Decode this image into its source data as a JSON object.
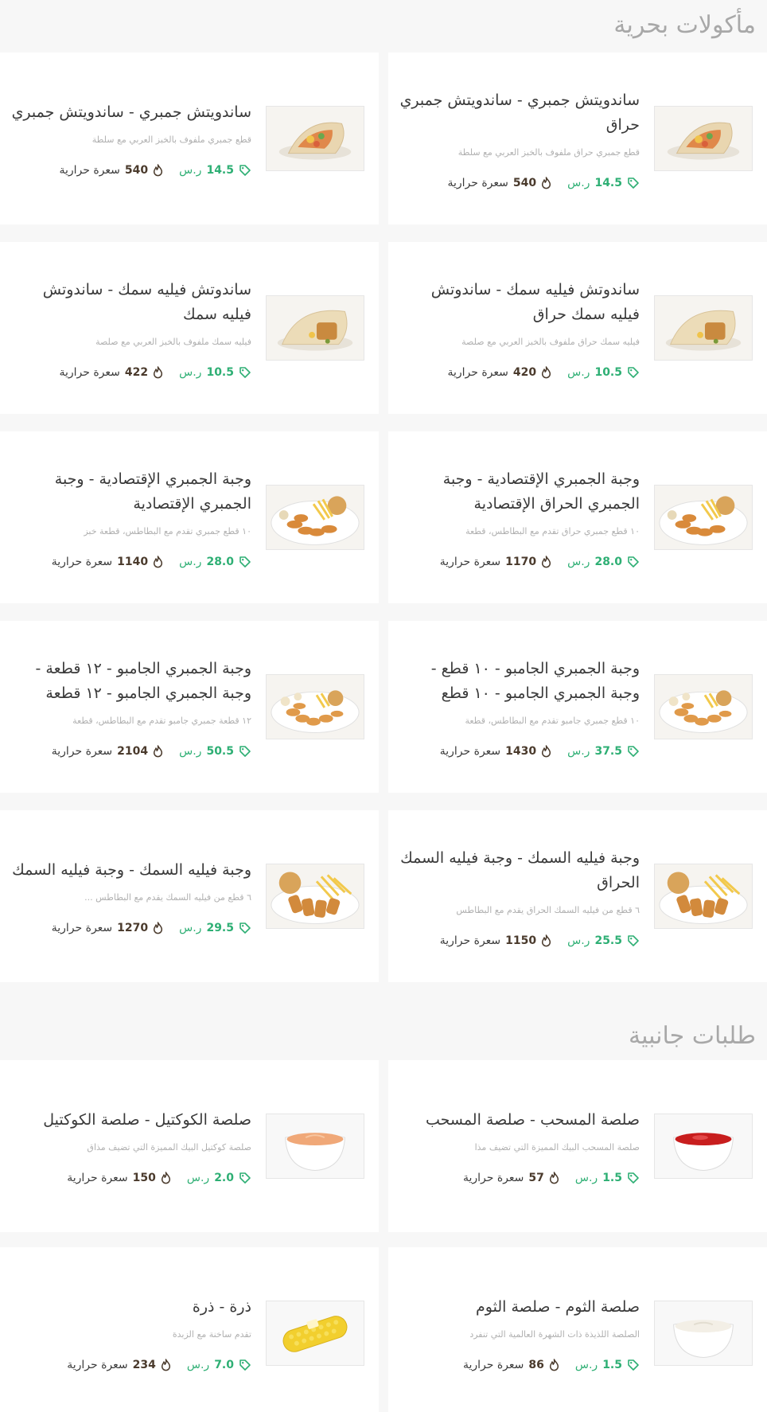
{
  "sections": [
    {
      "title": "مأكولات بحرية",
      "items": [
        {
          "name": "ساندويتش جمبري - ساندويتش جمبري حراق",
          "desc": "قطع جمبري حراق ملفوف بالخبز العربي مع سلطة",
          "price": "14.5",
          "currency": "ر.س",
          "calories": "540",
          "calories_unit": "سعرة حرارية",
          "image": "shrimp-wrap"
        },
        {
          "name": "ساندويتش جمبري - ساندويتش جمبري",
          "desc": "قطع جمبري ملفوف بالخبز العربي مع سلطة",
          "price": "14.5",
          "currency": "ر.س",
          "calories": "540",
          "calories_unit": "سعرة حرارية",
          "image": "shrimp-wrap"
        },
        {
          "name": "ساندوتش فيليه سمك - ساندوتش فيليه سمك حراق",
          "desc": "فيليه سمك حراق ملفوف بالخبز العربي مع صلصة",
          "price": "10.5",
          "currency": "ر.س",
          "calories": "420",
          "calories_unit": "سعرة حرارية",
          "image": "fish-wrap"
        },
        {
          "name": "ساندوتش فيليه سمك - ساندوتش فيليه سمك",
          "desc": "فيليه سمك ملفوف بالخبز العربي مع صلصة",
          "price": "10.5",
          "currency": "ر.س",
          "calories": "422",
          "calories_unit": "سعرة حرارية",
          "image": "fish-wrap"
        },
        {
          "name": "وجبة الجمبري الإقتصادية - وجبة الجمبري الحراق الإقتصادية",
          "desc": "١٠ قطع جمبري حراق تقدم مع البطاطس، قطعة",
          "price": "28.0",
          "currency": "ر.س",
          "calories": "1170",
          "calories_unit": "سعرة حرارية",
          "image": "shrimp-meal"
        },
        {
          "name": "وجبة الجمبري الإقتصادية - وجبة الجمبري الإقتصادية",
          "desc": "١٠ قطع جمبري تقدم مع البطاطس، قطعة خبز",
          "price": "28.0",
          "currency": "ر.س",
          "calories": "1140",
          "calories_unit": "سعرة حرارية",
          "image": "shrimp-meal"
        },
        {
          "name": "وجبة الجمبري الجامبو - ١٠ قطع - وجبة الجمبري الجامبو - ١٠ قطع",
          "desc": "١٠ قطع جمبري جامبو تقدم مع البطاطس، قطعة",
          "price": "37.5",
          "currency": "ر.س",
          "calories": "1430",
          "calories_unit": "سعرة حرارية",
          "image": "jumbo-meal"
        },
        {
          "name": "وجبة الجمبري الجامبو - ١٢ قطعة - وجبة الجمبري الجامبو - ١٢ قطعة",
          "desc": "١٢ قطعة جمبري جامبو تقدم مع البطاطس، قطعة",
          "price": "50.5",
          "currency": "ر.س",
          "calories": "2104",
          "calories_unit": "سعرة حرارية",
          "image": "jumbo-meal"
        },
        {
          "name": "وجبة فيليه السمك - وجبة فيليه السمك الحراق",
          "desc": "٦ قطع من فيليه السمك الحراق يقدم مع البطاطس",
          "price": "25.5",
          "currency": "ر.س",
          "calories": "1150",
          "calories_unit": "سعرة حرارية",
          "image": "fish-meal"
        },
        {
          "name": "وجبة فيليه السمك - وجبة فيليه السمك",
          "desc": "٦ قطع من فيليه السمك يقدم مع البطاطس ...",
          "price": "29.5",
          "currency": "ر.س",
          "calories": "1270",
          "calories_unit": "سعرة حرارية",
          "image": "fish-meal"
        }
      ]
    },
    {
      "title": "طلبات جانبية",
      "items": [
        {
          "name": "صلصة المسحب - صلصة المسحب",
          "desc": "صلصة المسحب البيك المميزة التي تضيف مذا",
          "price": "1.5",
          "currency": "ر.س",
          "calories": "57",
          "calories_unit": "سعرة حرارية",
          "image": "red-sauce"
        },
        {
          "name": "صلصة الكوكتيل - صلصة الكوكتيل",
          "desc": "صلصة كوكتيل البيك المميزة التي تضيف مذاق",
          "price": "2.0",
          "currency": "ر.س",
          "calories": "150",
          "calories_unit": "سعرة حرارية",
          "image": "cocktail-sauce"
        },
        {
          "name": "صلصة الثوم - صلصة الثوم",
          "desc": "الصلصة اللذيذة ذات الشهرة العالمية التي تنفرد",
          "price": "1.5",
          "currency": "ر.س",
          "calories": "86",
          "calories_unit": "سعرة حرارية",
          "image": "garlic-sauce"
        },
        {
          "name": "ذرة - ذرة",
          "desc": "تقدم ساخنة مع الزبدة",
          "price": "7.0",
          "currency": "ر.س",
          "calories": "234",
          "calories_unit": "سعرة حرارية",
          "image": "corn"
        }
      ]
    }
  ],
  "colors": {
    "price": "#2eaf74",
    "calories": "#4a3a2c",
    "section_title": "#a8a8a8",
    "card": "#ffffff",
    "page": "#f7f7f7"
  },
  "icons": {
    "price": "price-tag-icon",
    "calories": "flame-icon"
  }
}
